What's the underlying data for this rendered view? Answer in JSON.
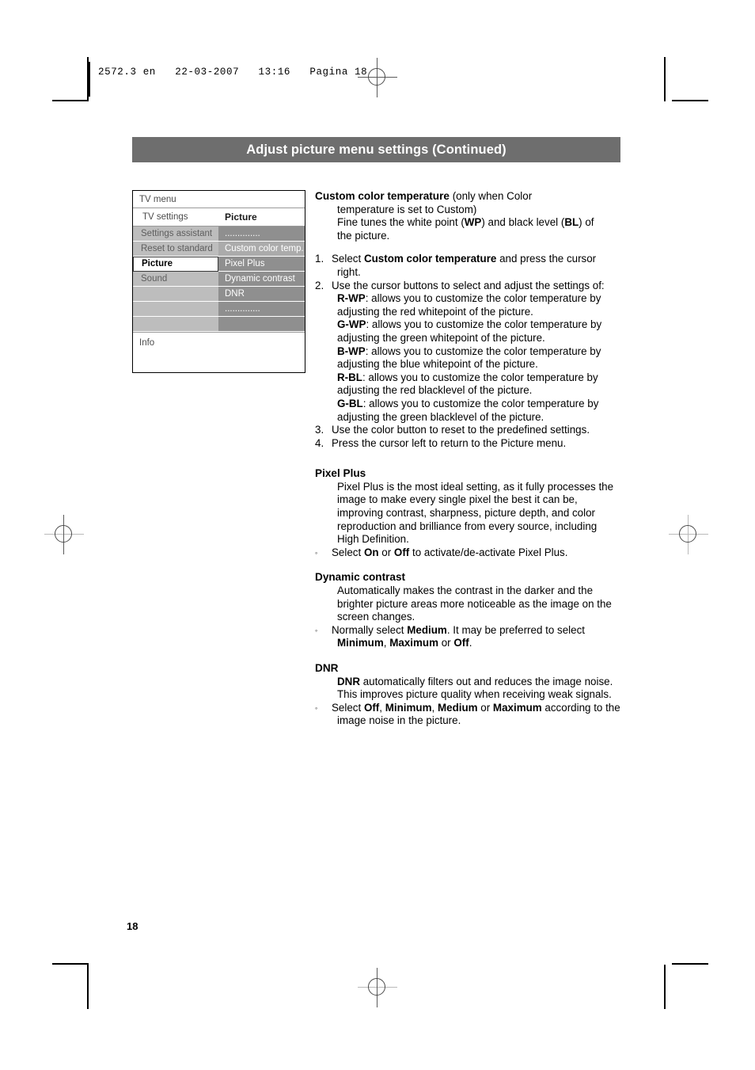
{
  "slug": {
    "text": "2572.3 en   22-03-2007   13:16   Pagina 18"
  },
  "title_bar": {
    "text": "Adjust picture menu settings  (Continued)"
  },
  "tv_menu": {
    "title": "TV menu",
    "sub_left": "TV settings",
    "sub_right": "Picture",
    "rows": [
      {
        "left": "Settings assistant",
        "right": "..............",
        "left_state": "normal",
        "right_state": "normal"
      },
      {
        "left": "Reset to standard",
        "right": "Custom color temp.",
        "left_state": "normal",
        "right_state": "highlighted"
      },
      {
        "left": "Picture",
        "right": "Pixel Plus",
        "left_state": "selected",
        "right_state": "normal"
      },
      {
        "left": "Sound",
        "right": "Dynamic contrast",
        "left_state": "normal",
        "right_state": "normal"
      },
      {
        "left": "",
        "right": "DNR",
        "left_state": "blank",
        "right_state": "normal"
      },
      {
        "left": "",
        "right": "..............",
        "left_state": "blank",
        "right_state": "normal"
      },
      {
        "left": "",
        "right": "",
        "left_state": "blank",
        "right_state": "blank"
      }
    ],
    "info_label": "Info"
  },
  "content": {
    "custom_color_temperature": {
      "heading": "Custom color temperature",
      "heading_suffix": "  (only when Color",
      "line2": "temperature is set to Custom)",
      "line3_a": "Fine tunes the white point (",
      "line3_wp": "WP",
      "line3_b": ") and black level (",
      "line3_bl": "BL",
      "line3_c": ") of",
      "line4": "the picture.",
      "steps": [
        {
          "num": "1.",
          "text_a": "Select ",
          "bold": "Custom color temperature",
          "text_b": " and press the cursor right."
        },
        {
          "num": "2.",
          "text_a": "Use the cursor buttons to select and adjust the settings of:"
        },
        {
          "num": "3.",
          "text_a": "Use the color button to reset to the predefined settings."
        },
        {
          "num": "4.",
          "text_a": "Press the cursor left to return to the Picture menu."
        }
      ],
      "params": [
        {
          "key": "R-WP",
          "desc": ": allows you to customize the color temperature by adjusting the red whitepoint of the picture."
        },
        {
          "key": "G-WP",
          "desc": ": allows you to customize the color temperature by adjusting the green whitepoint of the picture."
        },
        {
          "key": "B-WP",
          "desc": ": allows you to customize the color temperature by adjusting the blue whitepoint of the picture."
        },
        {
          "key": "R-BL",
          "desc": ": allows you to customize the color temperature  by adjusting the red blacklevel of the picture."
        },
        {
          "key": "G-BL",
          "desc": ": allows you to customize the color temperature by adjusting the green blacklevel of the picture."
        }
      ]
    },
    "pixel_plus": {
      "heading": "Pixel Plus",
      "body": "Pixel Plus is the most ideal setting, as it fully processes the image to make every single pixel the best it can be, improving contrast, sharpness, picture depth, and color reproduction and brilliance from every source, including High Definition.",
      "bullet_a": "Select ",
      "bullet_on": "On",
      "bullet_mid": " or ",
      "bullet_off": "Off",
      "bullet_b": " to activate/de-activate Pixel Plus."
    },
    "dynamic_contrast": {
      "heading": "Dynamic contrast",
      "body": "Automatically makes the contrast in the darker and the brighter picture areas more noticeable as the image on the screen changes.",
      "bullet_a": "Normally select ",
      "bullet_medium": "Medium",
      "bullet_b": ". It may be preferred to select ",
      "bullet_minimum": "Minimum",
      "bullet_c": ", ",
      "bullet_maximum": "Maximum",
      "bullet_d": " or ",
      "bullet_off": "Off",
      "bullet_e": "."
    },
    "dnr": {
      "heading": "DNR",
      "body_bold": "DNR",
      "body": " automatically filters out and reduces the image noise. This improves picture quality when receiving weak signals.",
      "bullet_a": "Select ",
      "bullet_off": "Off",
      "bullet_b": ", ",
      "bullet_minimum": "Minimum",
      "bullet_c": ", ",
      "bullet_medium": "Medium",
      "bullet_d": " or ",
      "bullet_maximum": "Maximum",
      "bullet_e": " according to the image noise in the picture."
    }
  },
  "page_number": "18",
  "colors": {
    "title_bar_bg": "#6e6e6e",
    "menu_left_bg": "#bdbdbd",
    "menu_right_bg": "#8f8f8f",
    "menu_highlight_bg": "#ababab"
  }
}
